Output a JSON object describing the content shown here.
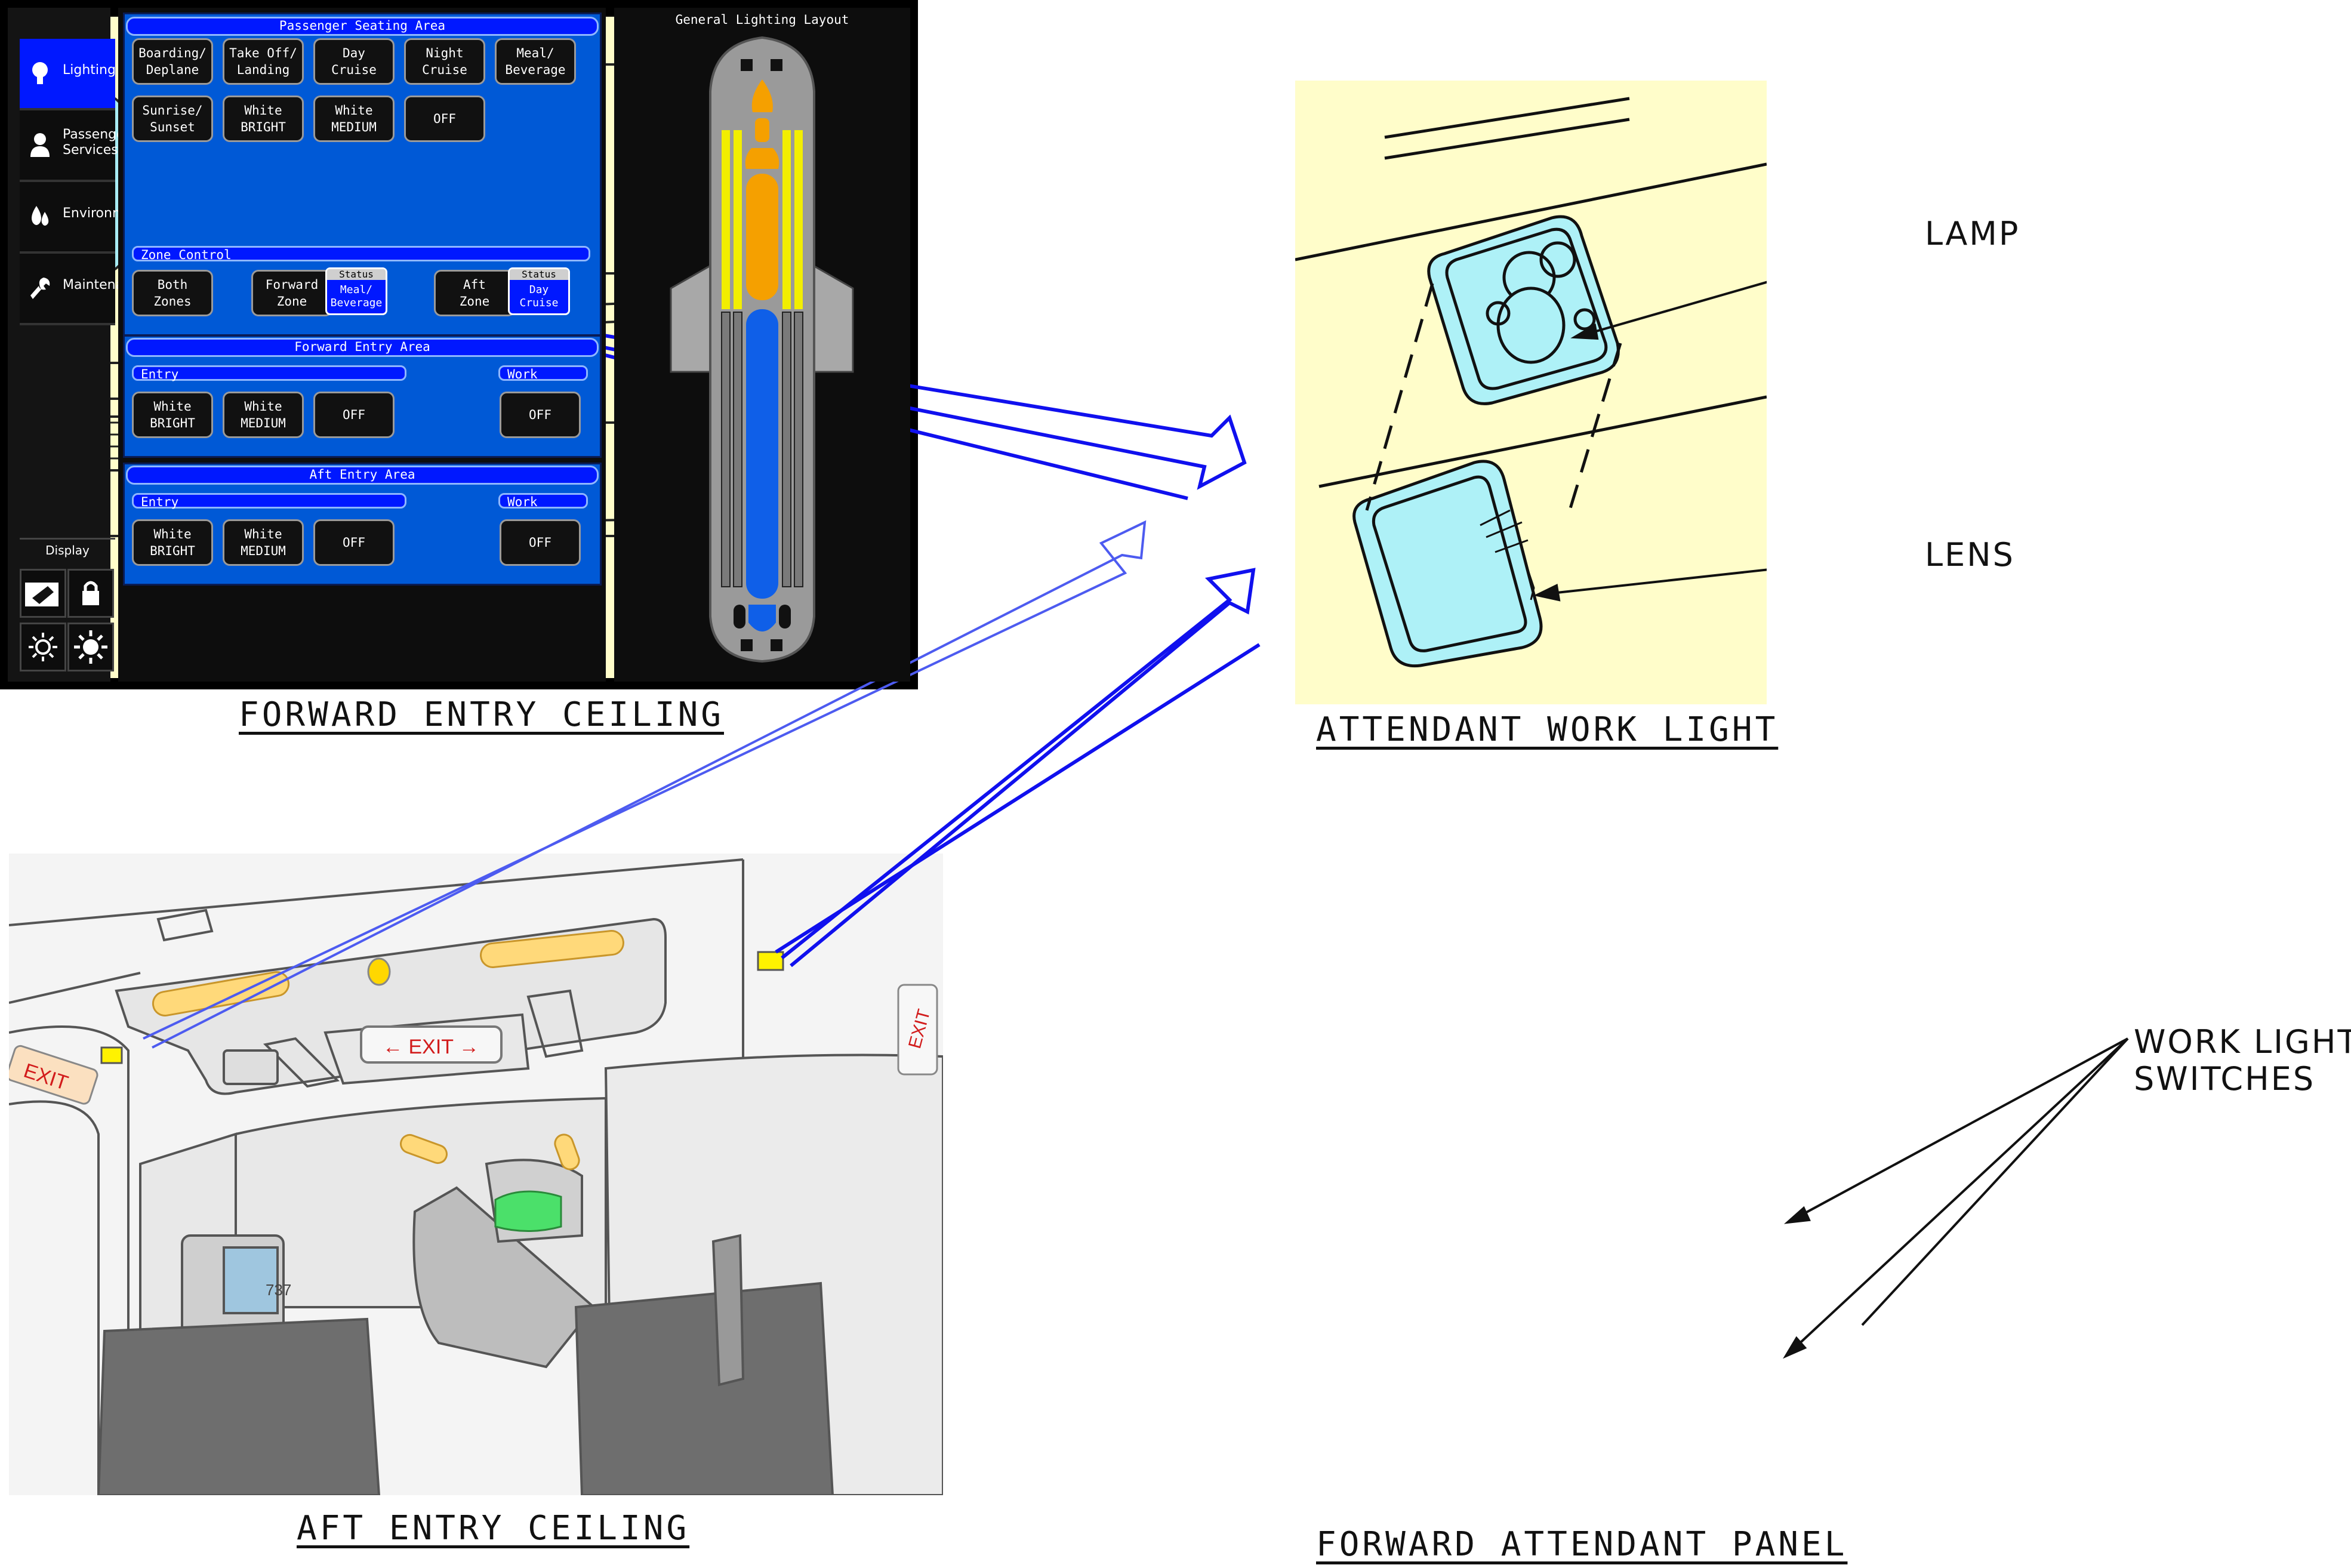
{
  "captions": {
    "forward_entry": "FORWARD ENTRY CEILING",
    "work_light": "ATTENDANT WORK LIGHT",
    "aft_entry": "AFT ENTRY CEILING",
    "forward_panel": "FORWARD ATTENDANT PANEL"
  },
  "callouts": {
    "lamp": "LAMP",
    "lens": "LENS",
    "switches_line1": "WORK LIGHT",
    "switches_line2": "SWITCHES"
  },
  "aft_scene": {
    "exit_center": "← EXIT →",
    "exit_left": "EXIT",
    "exit_right": "EXIT",
    "door_number": "737"
  },
  "panel": {
    "sidebar": [
      {
        "label": "Lighting",
        "icon": "bulb-icon",
        "active": true
      },
      {
        "label": "Passenger\nServices",
        "icon": "passenger-icon",
        "active": false
      },
      {
        "label": "Environment",
        "icon": "droplets-icon",
        "active": false
      },
      {
        "label": "Maintenance",
        "icon": "wrench-icon",
        "active": false
      }
    ],
    "display_label": "Display",
    "display_buttons": [
      "cleaning-icon",
      "lock-icon",
      "brightness-down-icon",
      "brightness-up-icon"
    ],
    "seating": {
      "title": "Passenger Seating Area",
      "buttons": [
        "Boarding/\nDeplane",
        "Take Off/\nLanding",
        "Day\nCruise",
        "Night\nCruise",
        "Meal/\nBeverage",
        "Sunrise/\nSunset",
        "White\nBRIGHT",
        "White\nMEDIUM",
        "OFF"
      ]
    },
    "zone": {
      "title": "Zone Control",
      "both": "Both\nZones",
      "forward": "Forward\nZone",
      "aft": "Aft\nZone",
      "status_label": "Status",
      "forward_status": "Meal/\nBeverage",
      "aft_status": "Day\nCruise"
    },
    "forward_entry": {
      "title": "Forward Entry Area",
      "entry_label": "Entry",
      "work_label": "Work",
      "entry_buttons": [
        "White\nBRIGHT",
        "White\nMEDIUM",
        "OFF"
      ],
      "work_button": "OFF"
    },
    "aft_entry": {
      "title": "Aft Entry Area",
      "entry_label": "Entry",
      "work_label": "Work",
      "entry_buttons": [
        "White\nBRIGHT",
        "White\nMEDIUM",
        "OFF"
      ],
      "work_button": "OFF"
    },
    "layout_title": "General Lighting Layout"
  },
  "colors": {
    "ceiling_bg": "#fffdca",
    "arrow_blue": "#1010ee",
    "panel_blue": "#0059d6",
    "header_blue": "#0018ff",
    "layout_yellow": "#f2ee00",
    "layout_orange": "#f5a000",
    "layout_blue": "#0f5fe8"
  }
}
